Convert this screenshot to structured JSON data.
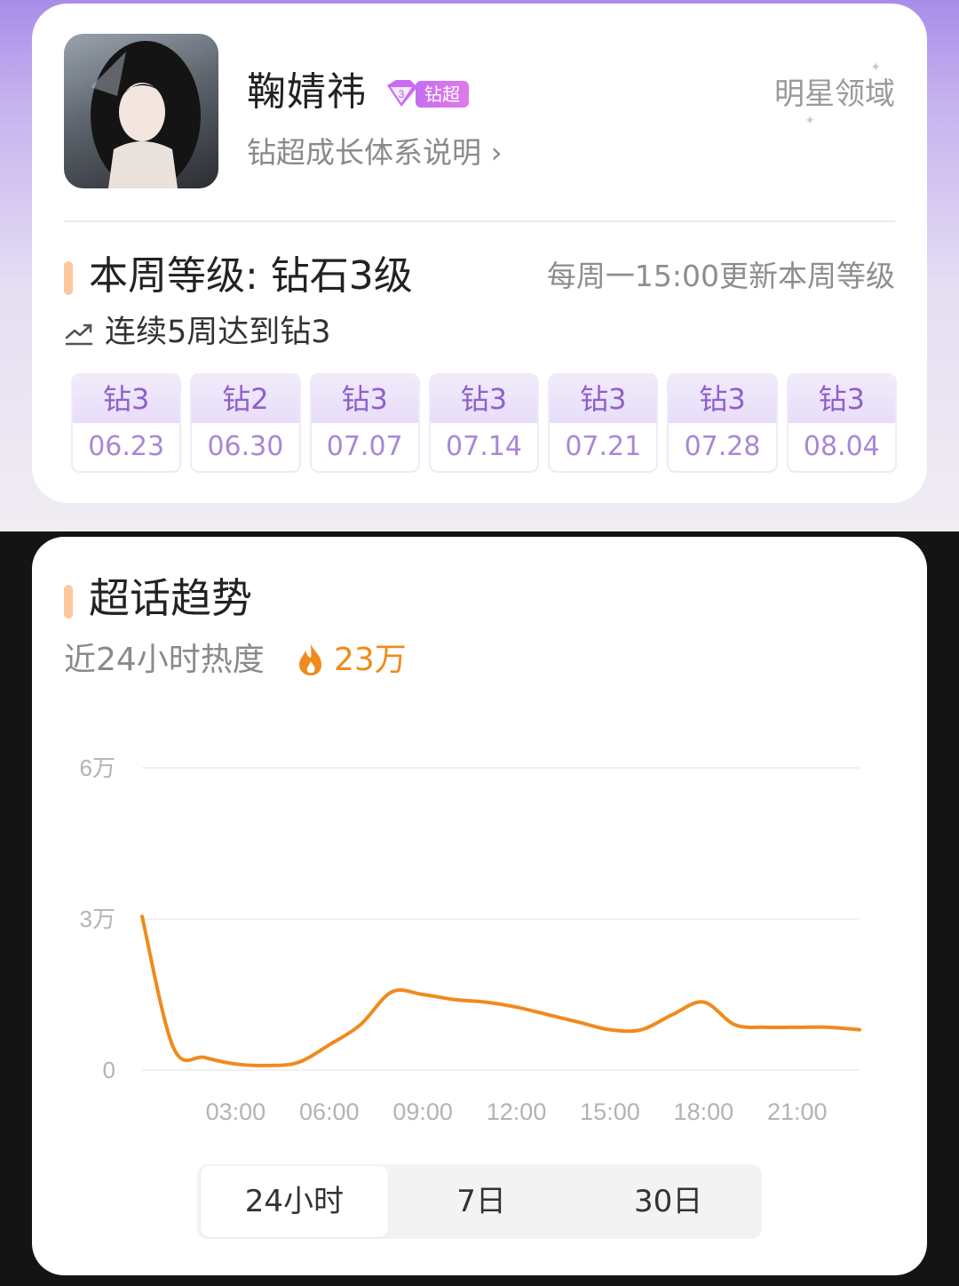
{
  "profile": {
    "name": "鞠婧祎",
    "badge_label": "钻超",
    "growth_link": "钻超成长体系说明 ›",
    "star_domain": "明星领域"
  },
  "level": {
    "title": "本周等级: 钻石3级",
    "update_note": "每周一15:00更新本周等级",
    "streak": "连续5周达到钻3",
    "weeks": [
      {
        "level": "钻3",
        "date": "06.23"
      },
      {
        "level": "钻2",
        "date": "06.30"
      },
      {
        "level": "钻3",
        "date": "07.07"
      },
      {
        "level": "钻3",
        "date": "07.14"
      },
      {
        "level": "钻3",
        "date": "07.21"
      },
      {
        "level": "钻3",
        "date": "07.28"
      },
      {
        "level": "钻3",
        "date": "08.04"
      }
    ]
  },
  "trend": {
    "title": "超话趋势",
    "heat_label": "近24小时热度",
    "heat_value": "23万",
    "tabs": [
      "24小时",
      "7日",
      "30日"
    ],
    "active_tab": "24小时"
  },
  "colors": {
    "accent_orange": "#f08a1c",
    "section_marker": "#ffc79c",
    "purple_text": "#8e60c9"
  },
  "chart_data": {
    "type": "line",
    "xlabel": "",
    "ylabel": "",
    "xlim": [
      0,
      23
    ],
    "ylim": [
      0,
      60000
    ],
    "grid": true,
    "y_ticks": [
      {
        "value": 0,
        "label": "0"
      },
      {
        "value": 30000,
        "label": "3万"
      },
      {
        "value": 60000,
        "label": "6万"
      }
    ],
    "x_ticks": [
      {
        "value": 3,
        "label": "03:00"
      },
      {
        "value": 6,
        "label": "06:00"
      },
      {
        "value": 9,
        "label": "09:00"
      },
      {
        "value": 12,
        "label": "12:00"
      },
      {
        "value": 15,
        "label": "15:00"
      },
      {
        "value": 18,
        "label": "18:00"
      },
      {
        "value": 21,
        "label": "21:00"
      }
    ],
    "series": [
      {
        "color": "#f08a1c",
        "x": [
          0,
          1,
          2,
          3,
          4,
          5,
          6,
          7,
          8,
          9,
          10,
          11,
          12,
          13,
          14,
          15,
          16,
          17,
          18,
          19,
          20,
          21,
          22,
          23
        ],
        "values": [
          30500,
          4500,
          2500,
          1200,
          900,
          1500,
          5000,
          9000,
          15500,
          15000,
          14000,
          13500,
          12500,
          11000,
          9500,
          8000,
          8000,
          11000,
          13500,
          9000,
          8500,
          8500,
          8500,
          8000
        ]
      }
    ]
  }
}
